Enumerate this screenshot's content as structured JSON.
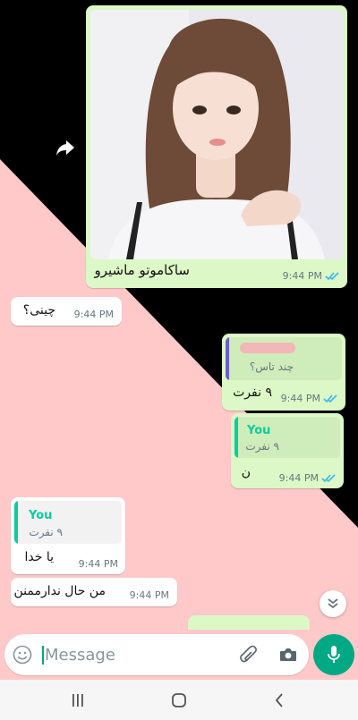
{
  "colors": {
    "wallpaper_pink": "#ffc9c9",
    "wallpaper_dark": "#000000",
    "outgoing_bubble": "#dcf8c6",
    "incoming_bubble": "#ffffff",
    "accent": "#00a884",
    "read_ticks": "#34b7f1",
    "quote_bar_own": "#06cf9c",
    "quote_bar_other": "#6b5fce"
  },
  "messages": [
    {
      "direction": "outgoing",
      "type": "image",
      "caption": "ساکاموتو ماشیرو",
      "time": "9:44 PM",
      "status": "read"
    },
    {
      "direction": "incoming",
      "type": "text",
      "text": "چینی؟",
      "time": "9:44 PM"
    },
    {
      "direction": "outgoing",
      "type": "reply",
      "quote_text": "چند تاس؟",
      "text": "۹ نفرت",
      "time": "9:44 PM",
      "status": "read"
    },
    {
      "direction": "outgoing",
      "type": "reply",
      "quote_name": "You",
      "quote_text": "۹ نفرت",
      "text": "ن",
      "time": "9:44 PM",
      "status": "read"
    },
    {
      "direction": "incoming",
      "type": "reply",
      "quote_name": "You",
      "quote_text": "۹ نفرت",
      "text": "یا خدا",
      "time": "9:44 PM"
    },
    {
      "direction": "incoming",
      "type": "text",
      "text": "من حال ندارممنن",
      "time": "9:44 PM"
    }
  ],
  "composer": {
    "placeholder": "Message",
    "emoji_icon": "emoji-icon",
    "attach_icon": "paperclip-icon",
    "camera_icon": "camera-icon",
    "mic_icon": "mic-icon"
  },
  "nav_bar": {
    "recents_icon": "recents-icon",
    "home_icon": "home-icon",
    "back_icon": "back-icon"
  }
}
